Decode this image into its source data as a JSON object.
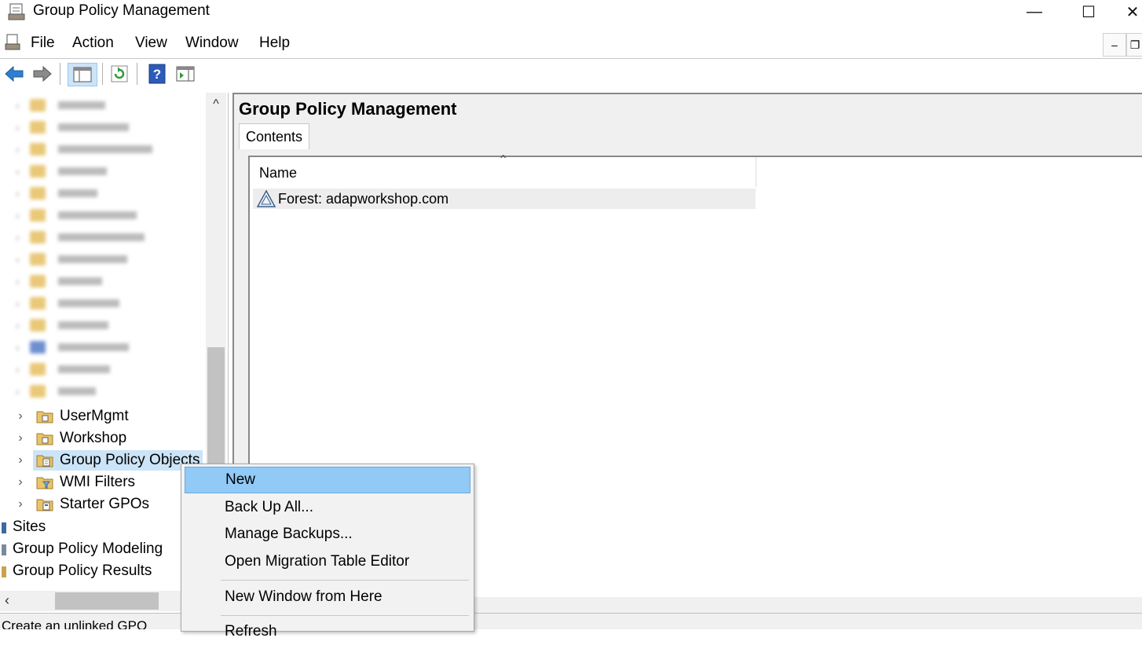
{
  "window": {
    "title": "Group Policy Management",
    "minimize_label": "—",
    "maximize_label": "☐",
    "close_label": "✕"
  },
  "menubar": {
    "items": [
      {
        "label": "File"
      },
      {
        "label": "Action"
      },
      {
        "label": "View"
      },
      {
        "label": "Window"
      },
      {
        "label": "Help"
      }
    ]
  },
  "toolbar": {
    "buttons": [
      "back-arrow-icon",
      "forward-arrow-icon",
      "show-hide-console-tree-icon",
      "refresh-icon",
      "help-icon",
      "show-action-pane-icon"
    ]
  },
  "tree": {
    "blurred_items": [
      "",
      "",
      "",
      "",
      "",
      "",
      "",
      "",
      "",
      "",
      "",
      "",
      "",
      "",
      ""
    ],
    "nodes": [
      {
        "label": "UserMgmt",
        "icon": "ou-folder-icon"
      },
      {
        "label": "Workshop",
        "icon": "ou-folder-icon"
      },
      {
        "label": "Group Policy Objects",
        "icon": "gpo-folder-icon",
        "selected": true
      },
      {
        "label": "WMI Filters",
        "icon": "wmi-filter-folder-icon"
      },
      {
        "label": "Starter GPOs",
        "icon": "starter-gpo-folder-icon"
      }
    ],
    "root_nodes": [
      {
        "label": "Sites",
        "icon": "sites-icon"
      },
      {
        "label": "Group Policy Modeling",
        "icon": "modeling-icon"
      },
      {
        "label": "Group Policy Results",
        "icon": "results-icon"
      }
    ]
  },
  "main": {
    "title": "Group Policy Management",
    "tab": "Contents",
    "column_header": "Name",
    "rows": [
      {
        "label": "Forest: adapworkshop.com",
        "icon": "forest-icon"
      }
    ]
  },
  "context_menu": {
    "items": [
      {
        "label": "New",
        "highlighted": true
      },
      {
        "label": "Back Up All..."
      },
      {
        "label": "Manage Backups..."
      },
      {
        "label": "Open Migration Table Editor"
      },
      {
        "label": "New Window from Here"
      },
      {
        "label": "Refresh"
      }
    ]
  },
  "status": {
    "text": "Create an unlinked GPO"
  }
}
